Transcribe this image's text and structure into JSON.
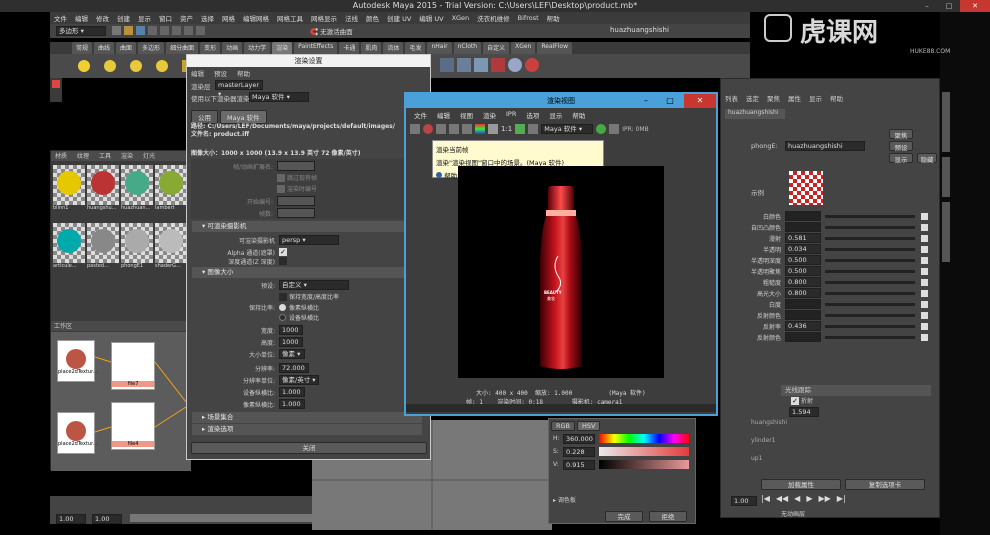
{
  "maya": {
    "title": "Autodesk Maya 2015 - Trial Version: C:\\Users\\LEF\\Desktop\\product.mb*",
    "menus": [
      "文件",
      "编辑",
      "修改",
      "创建",
      "显示",
      "窗口",
      "资产",
      "选择",
      "网格",
      "编辑网格",
      "网格工具",
      "网格显示",
      "法线",
      "颜色",
      "创建 UV",
      "编辑 UV",
      "XGen",
      "洗衣机维修",
      "Bifrost",
      "帮助"
    ],
    "mode_dropdown": "多边形",
    "live_surface": "无激活曲面",
    "shelf_tabs": [
      "常规",
      "曲线",
      "曲面",
      "多边形",
      "细分曲面",
      "变形",
      "动画",
      "动力学",
      "渲染",
      "PaintEffects",
      "卡通",
      "肌肉",
      "流体",
      "毛发",
      "nHair",
      "nCloth",
      "自定义",
      "XGen",
      "RealFlow"
    ],
    "user": "huazhuangshishi"
  },
  "watermark": {
    "text": "虎课网",
    "sub": "HUKE88.COM"
  },
  "hypershade": {
    "tabs": [
      "材质",
      "纹理",
      "工具",
      "渲染",
      "灯光"
    ],
    "swatches": [
      "blinn1",
      "huangshu...",
      "huazhuan...",
      "lambert",
      "articule...",
      "pasted...",
      "phongE1",
      "shaderG..."
    ],
    "work_area_label": "工作区",
    "nodes": [
      "place2dTextur...",
      "file7",
      "file4",
      "place2dTextur..."
    ]
  },
  "render_settings": {
    "title": "渲染设置",
    "menu": [
      "编辑",
      "预设",
      "帮助"
    ],
    "render_layer_label": "渲染层",
    "render_layer_value": "masterLayer",
    "render_using_label": "使用以下渲染器渲染",
    "render_using_value": "Maya 软件",
    "tabs": [
      "公用",
      "Maya 软件"
    ],
    "path_label": "路径:",
    "path_value": "C:/Users/LEF/Documents/maya/projects/default/images/",
    "file_name_label": "文件名:",
    "file_name_value": "product.iff",
    "image_size_text": "图像大小：1000 x 1000 (13.9 x 13.9 英寸 72 像素/英寸)",
    "rows_top": [
      "帧/动画扩展名:",
      "开始帧:",
      "结束帧:",
      "帧数:",
      "跳过现有帧",
      "渲染时编号",
      "开始编号:",
      "帧数:"
    ],
    "section_camera": "可渲染摄影机",
    "camera_label": "可渲染摄影机",
    "camera_value": "persp",
    "alpha_label": "Alpha 通道(遮罩)",
    "depth_label": "深度通道(Z 深度)",
    "section_size": "图像大小",
    "preset_label": "预设:",
    "preset_value": "自定义",
    "keep_ratio_label": "保持宽度/高度比率",
    "keep_ratio_type_label": "保持比率:",
    "pixel_aspect": "像素纵横比",
    "device_aspect": "设备纵横比",
    "width_label": "宽度:",
    "width_value": "1000",
    "height_label": "高度:",
    "height_value": "1000",
    "size_units_label": "大小单位:",
    "size_units_value": "像素",
    "resolution_label": "分辨率:",
    "resolution_value": "72.000",
    "res_units_label": "分辨率单位:",
    "res_units_value": "像素/英寸",
    "device_aspect_label": "设备纵横比:",
    "device_aspect_value": "1.000",
    "pixel_aspect_label": "像素纵横比:",
    "pixel_aspect_value": "1.000",
    "section_scene": "场景集合",
    "section_render_options": "渲染选项",
    "close_button": "关闭"
  },
  "render_view": {
    "title": "渲染视图",
    "menu": [
      "文件",
      "编辑",
      "视图",
      "渲染",
      "IPR",
      "选项",
      "显示",
      "帮助"
    ],
    "renderer": "Maya 软件",
    "ratio_label": "1:1",
    "ipr_label": "IPR: 0MB",
    "tooltip_title": "渲染当前帧",
    "tooltip_body": "渲染\"渲染视图\"窗口中的场景。(Maya 软件)",
    "tooltip_help": "帮助",
    "bottle_brand": "BEAUTY",
    "bottle_text": "美妆",
    "status_line1": "大小: 400 x 400  缩放: 1.000          (Maya 软件)",
    "status_line2": "帧: 1    渲染时间: 0:18        摄影机: camera1"
  },
  "color_chooser": {
    "tabs": [
      "RGB",
      "HSV"
    ],
    "h_label": "H:",
    "h_value": "360.000",
    "s_label": "S:",
    "s_value": "0.228",
    "v_label": "V:",
    "v_value": "0.915",
    "palette_label": "调色板",
    "accept": "完成",
    "cancel": "拒绝"
  },
  "attribute_editor": {
    "tabs": [
      "列表",
      "选定",
      "聚焦",
      "属性",
      "显示",
      "帮助"
    ],
    "node_tab": "huazhuangshishi",
    "type_label": "phongE:",
    "type_value": "huazhuangshishi",
    "focus_button": "聚焦",
    "presets_button": "预设",
    "show_button": "显示",
    "hide_button": "隐藏",
    "sample_label": "示例",
    "rows": [
      {
        "label": "白颜色",
        "value": ""
      },
      {
        "label": "自凹凸颜色",
        "value": ""
      },
      {
        "label": "漫射",
        "value": "0.581"
      },
      {
        "label": "半透明",
        "value": "0.034"
      },
      {
        "label": "半透明深度",
        "value": "0.500"
      },
      {
        "label": "半透明聚焦",
        "value": "0.500"
      },
      {
        "label": "粗糙度",
        "value": "0.800"
      },
      {
        "label": "高光大小",
        "value": "0.800"
      },
      {
        "label": "白度",
        "value": ""
      },
      {
        "label": "反射颜色",
        "value": ""
      },
      {
        "label": "反射率",
        "value": "0.436"
      },
      {
        "label": "反射颜色",
        "value": ""
      }
    ],
    "section_raytrace": "光线跟踪",
    "refraction_label": "折射",
    "refraction_index": "1.594",
    "load_attrs": "加载属性",
    "copy_tab": "复制选项卡",
    "outliner_items": [
      "huangshishi",
      "ylinder1",
      "up1"
    ],
    "timeline_values": [
      "1.00",
      "1.00",
      "1.00",
      "1.00"
    ],
    "anim_layer": "无动画层"
  }
}
